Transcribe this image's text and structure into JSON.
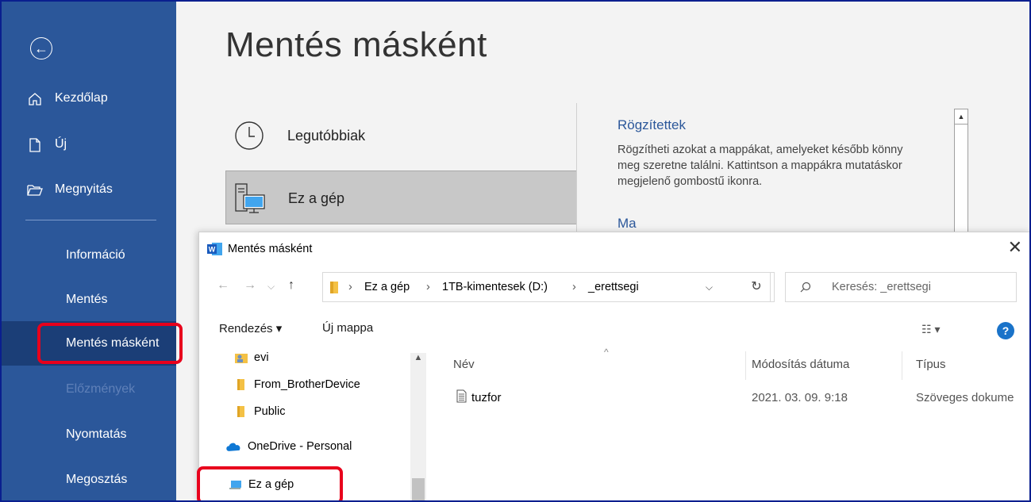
{
  "sidebar": {
    "back_icon": "back-arrow-icon",
    "items": [
      {
        "label": "Kezdőlap",
        "icon": "home-icon"
      },
      {
        "label": "Új",
        "icon": "new-document-icon"
      },
      {
        "label": "Megnyitás",
        "icon": "open-folder-icon"
      },
      {
        "label": "Információ"
      },
      {
        "label": "Mentés"
      },
      {
        "label": "Mentés másként"
      },
      {
        "label": "Előzmények"
      },
      {
        "label": "Nyomtatás"
      },
      {
        "label": "Megosztás"
      }
    ],
    "active": "Mentés másként",
    "disabled": "Előzmények"
  },
  "backstage": {
    "title": "Mentés másként",
    "locations": [
      {
        "label": "Legutóbbiak",
        "icon": "clock-icon"
      },
      {
        "label": "Ez a gép",
        "icon": "computer-icon"
      }
    ],
    "pinned_title": "Rögzítettek",
    "pinned_text_lines": [
      "Rögzítheti azokat a mappákat, amelyeket később könny",
      "meg szeretne találni. Kattintson a mappákra mutatáskor",
      "megjelenő gombostű ikonra."
    ],
    "today_label": "Ma"
  },
  "dialog": {
    "title": "Mentés másként",
    "close": "✕",
    "nav": {
      "back": "←",
      "forward": "→",
      "recent": "⌵",
      "up": "↑"
    },
    "address": [
      "Ez a gép",
      "1TB-kimentesek (D:)",
      "_erettsegi"
    ],
    "address_sep": "›",
    "address_dropdown": "⌵",
    "refresh": "↻",
    "search_placeholder": "Keresés: _erettsegi",
    "search_icon": "⚲",
    "toolbar": {
      "organize": "Rendezés ▾",
      "new_folder": "Új mappa",
      "view": "☷ ▾",
      "help": "?"
    },
    "nav_pane": [
      "evi",
      "From_BrotherDevice",
      "Public",
      "OneDrive - Personal",
      "Ez a gép"
    ],
    "columns": [
      "Név",
      "Módosítás dátuma",
      "Típus"
    ],
    "files": [
      {
        "name": "tuzfor",
        "modified": "2021. 03. 09. 9:18",
        "type": "Szöveges dokume"
      }
    ]
  },
  "colors": {
    "sidebar": "#2b579a",
    "active": "#1b3e77",
    "highlight": "#e8001c",
    "accent": "#2b579a",
    "frame": "#0a1f8f"
  }
}
